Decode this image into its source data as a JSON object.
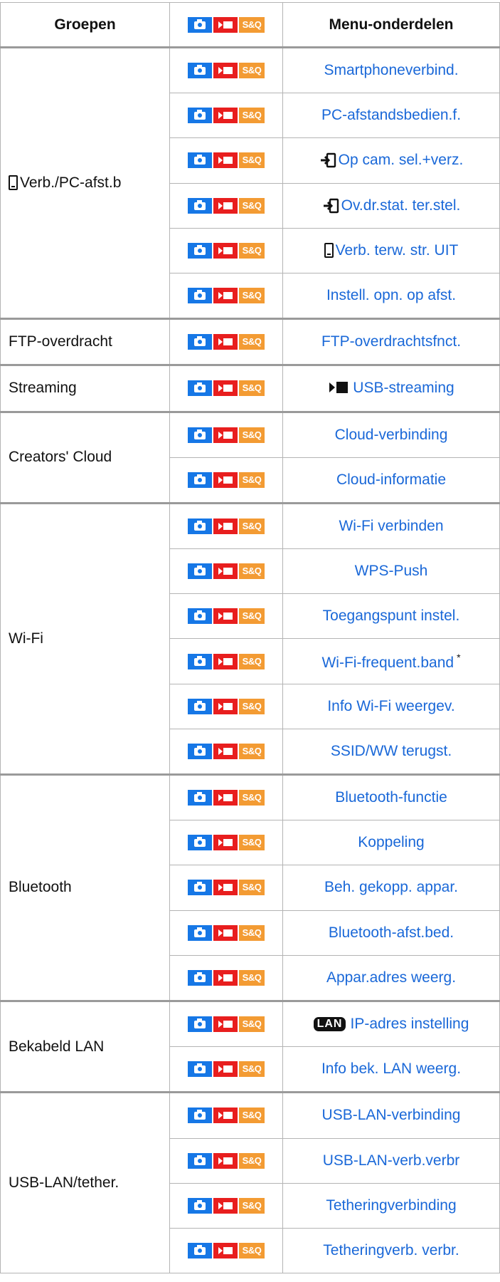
{
  "header": {
    "groups": "Groepen",
    "items": "Menu-onderdelen"
  },
  "mode_icons": {
    "photo": "camera-icon",
    "movie": "movie-icon",
    "sq": "S&Q"
  },
  "colors": {
    "link": "#1a68d8",
    "photo_mode": "#1677e6",
    "movie_mode": "#e81e1e",
    "sq_mode": "#f39b33"
  },
  "groups": [
    {
      "name": "Verb./PC-afst.b",
      "icon": "smartphone-icon",
      "items": [
        {
          "label": "Smartphoneverbind."
        },
        {
          "label": "PC-afstandsbedien.f."
        },
        {
          "label": "Op cam. sel.+verz.",
          "icon": "transfer-icon"
        },
        {
          "label": "Ov.dr.stat. ter.stel.",
          "icon": "transfer-icon"
        },
        {
          "label": "Verb. terw. str. UIT",
          "icon": "smartphone-icon"
        },
        {
          "label": "Instell. opn. op afst."
        }
      ]
    },
    {
      "name": "FTP-overdracht",
      "items": [
        {
          "label": "FTP-overdrachtsfnct."
        }
      ]
    },
    {
      "name": "Streaming",
      "items": [
        {
          "label": "USB-streaming",
          "icon": "streaming-icon"
        }
      ]
    },
    {
      "name": "Creators' Cloud",
      "items": [
        {
          "label": "Cloud-verbinding"
        },
        {
          "label": "Cloud-informatie"
        }
      ]
    },
    {
      "name": "Wi-Fi",
      "items": [
        {
          "label": "Wi-Fi verbinden"
        },
        {
          "label": "WPS-Push"
        },
        {
          "label": "Toegangspunt instel."
        },
        {
          "label": "Wi-Fi-frequent.band",
          "note": "*"
        },
        {
          "label": "Info Wi-Fi weergev."
        },
        {
          "label": "SSID/WW terugst."
        }
      ]
    },
    {
      "name": "Bluetooth",
      "items": [
        {
          "label": "Bluetooth-functie"
        },
        {
          "label": "Koppeling"
        },
        {
          "label": "Beh. gekopp. appar."
        },
        {
          "label": "Bluetooth-afst.bed."
        },
        {
          "label": "Appar.adres weerg."
        }
      ]
    },
    {
      "name": "Bekabeld LAN",
      "items": [
        {
          "label": "IP-adres instelling",
          "icon": "lan-icon",
          "icon_text": "LAN"
        },
        {
          "label": "Info bek. LAN weerg."
        }
      ]
    },
    {
      "name": "USB-LAN/tether.",
      "items": [
        {
          "label": "USB-LAN-verbinding"
        },
        {
          "label": "USB-LAN-verb.verbr"
        },
        {
          "label": "Tetheringverbinding"
        },
        {
          "label": "Tetheringverb. verbr."
        }
      ]
    }
  ]
}
